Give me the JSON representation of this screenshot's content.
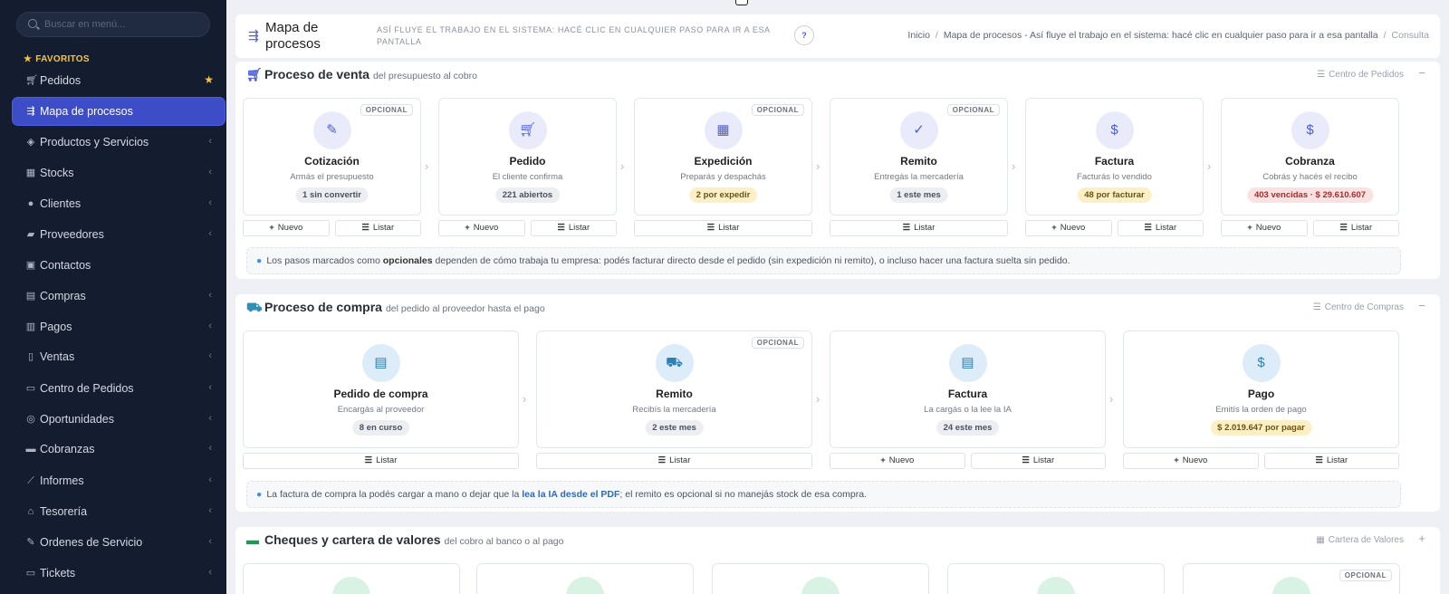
{
  "sidebar": {
    "search_placeholder": "Buscar en menú...",
    "favorites_label": "FAVORITOS",
    "items": [
      {
        "label": "Pedidos",
        "icon": "cart-icon",
        "glyph": "🛒︎"
      },
      {
        "label": "Mapa de procesos",
        "icon": "signpost-icon",
        "glyph": "⇶"
      },
      {
        "label": "Productos y Servicios",
        "icon": "tags-icon",
        "glyph": "◈"
      },
      {
        "label": "Stocks",
        "icon": "boxes-icon",
        "glyph": "▦"
      },
      {
        "label": "Clientes",
        "icon": "user-icon",
        "glyph": "●"
      },
      {
        "label": "Proveedores",
        "icon": "truck-icon",
        "glyph": "▰"
      },
      {
        "label": "Contactos",
        "icon": "address-book-icon",
        "glyph": "▣"
      },
      {
        "label": "Compras",
        "icon": "basket-icon",
        "glyph": "▤"
      },
      {
        "label": "Pagos",
        "icon": "receipt-icon",
        "glyph": "▥"
      },
      {
        "label": "Ventas",
        "icon": "file-icon",
        "glyph": "▯"
      },
      {
        "label": "Centro de Pedidos",
        "icon": "inbox-icon",
        "glyph": "▭"
      },
      {
        "label": "Oportunidades",
        "icon": "target-icon",
        "glyph": "◎"
      },
      {
        "label": "Cobranzas",
        "icon": "money-icon",
        "glyph": "▬"
      },
      {
        "label": "Informes",
        "icon": "chart-line-icon",
        "glyph": "⟋"
      },
      {
        "label": "Tesorería",
        "icon": "bank-icon",
        "glyph": "⌂"
      },
      {
        "label": "Ordenes de Servicio",
        "icon": "wrench-icon",
        "glyph": "✎"
      },
      {
        "label": "Tickets",
        "icon": "ticket-icon",
        "glyph": "▭"
      }
    ]
  },
  "header": {
    "title": "Mapa de procesos",
    "subtitle": "ASÍ FLUYE EL TRABAJO EN EL SISTEMA: HACÉ CLIC EN CUALQUIER PASO PARA IR A ESA PANTALLA",
    "help_label": "?",
    "breadcrumb": [
      "Inicio",
      "Mapa de procesos - Así fluye el trabajo en el sistema: hacé clic en cualquier paso para ir a esa pantalla",
      "Consulta"
    ]
  },
  "venta": {
    "title": "Proceso de venta",
    "subtitle": "del presupuesto al cobro",
    "link": "Centro de Pedidos",
    "toggle": "−",
    "steps": [
      {
        "name": "Cotización",
        "desc": "Armás el presupuesto",
        "badge": "1 sin convertir",
        "optional": "OPCIONAL",
        "icon": "pen-icon",
        "glyph": "✎"
      },
      {
        "name": "Pedido",
        "desc": "El cliente confirma",
        "badge": "221 abiertos",
        "optional": "",
        "icon": "cart-icon",
        "glyph": "🛒︎"
      },
      {
        "name": "Expedición",
        "desc": "Preparás y despachás",
        "badge": "2 por expedir",
        "optional": "OPCIONAL",
        "icon": "dolly-icon",
        "glyph": "▦"
      },
      {
        "name": "Remito",
        "desc": "Entregás la mercadería",
        "badge": "1 este mes",
        "optional": "OPCIONAL",
        "icon": "clipboard-check-icon",
        "glyph": "✓"
      },
      {
        "name": "Factura",
        "desc": "Facturás lo vendido",
        "badge": "48 por facturar",
        "optional": "",
        "icon": "invoice-icon",
        "glyph": "$"
      },
      {
        "name": "Cobranza",
        "desc": "Cobrás y hacés el recibo",
        "badge": "403 vencidas · $ 29.610.607",
        "optional": "",
        "icon": "hand-money-icon",
        "glyph": "$"
      }
    ],
    "new_label": "Nuevo",
    "list_label": "Listar",
    "note_pre": "Los pasos marcados como ",
    "note_bold": "opcionales",
    "note_post": " dependen de cómo trabaja tu empresa: podés facturar directo desde el pedido (sin expedición ni remito), o incluso hacer una factura suelta sin pedido."
  },
  "compra": {
    "title": "Proceso de compra",
    "subtitle": "del pedido al proveedor hasta el pago",
    "link": "Centro de Compras",
    "toggle": "−",
    "steps": [
      {
        "name": "Pedido de compra",
        "desc": "Encargás al proveedor",
        "badge": "8 en curso",
        "optional": "",
        "icon": "clipboard-list-icon",
        "glyph": "▤"
      },
      {
        "name": "Remito",
        "desc": "Recibís la mercadería",
        "badge": "2 este mes",
        "optional": "OPCIONAL",
        "icon": "dolly-icon",
        "glyph": "⛟"
      },
      {
        "name": "Factura",
        "desc": "La cargás o la lee la IA",
        "badge": "24 este mes",
        "optional": "",
        "icon": "file-text-icon",
        "glyph": "▤"
      },
      {
        "name": "Pago",
        "desc": "Emitís la orden de pago",
        "badge": "$ 2.019.647 por pagar",
        "optional": "",
        "icon": "money-check-icon",
        "glyph": "$"
      }
    ],
    "new_label": "Nuevo",
    "list_label": "Listar",
    "note_pre": "La factura de compra la podés cargar a mano o dejar que la ",
    "note_link": "lea la IA desde el PDF",
    "note_post": "; el remito es opcional si no manejás stock de esa compra."
  },
  "cheques": {
    "title": "Cheques y cartera de valores",
    "subtitle": "del cobro al banco o al pago",
    "link": "Cartera de Valores",
    "toggle": "+",
    "optional": "OPCIONAL"
  },
  "colors": {
    "sidebar_bg": "#141c30",
    "active": "#3d4cc7",
    "accent": "#4a5be0",
    "purple_circle": "#e9ebfb",
    "blue_circle": "#dcecf8",
    "green_circle": "#d8f3e3"
  }
}
